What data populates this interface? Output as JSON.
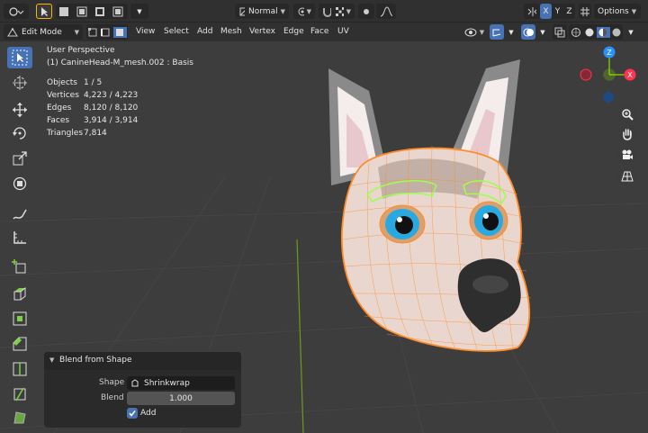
{
  "topbar": {
    "transform_orientation": "Normal",
    "axis_x": "X",
    "axis_y": "Y",
    "axis_z": "Z",
    "options_label": "Options"
  },
  "header": {
    "mode": "Edit Mode",
    "menus": [
      "View",
      "Select",
      "Add",
      "Mesh",
      "Vertex",
      "Edge",
      "Face",
      "UV"
    ]
  },
  "overlay": {
    "view_name": "User Perspective",
    "object_name": "(1) CanineHead-M_mesh.002 : Basis",
    "stats": [
      {
        "label": "Objects",
        "value": "1 / 5"
      },
      {
        "label": "Vertices",
        "value": "4,223 / 4,223"
      },
      {
        "label": "Edges",
        "value": "8,120 / 8,120"
      },
      {
        "label": "Faces",
        "value": "3,914 / 3,914"
      },
      {
        "label": "Triangles",
        "value": "7,814"
      }
    ]
  },
  "gizmo": {
    "z": "Z",
    "y": "Y",
    "x": "X"
  },
  "operator_panel": {
    "title": "Blend from Shape",
    "shape_label": "Shape",
    "shape_value": "Shrinkwrap",
    "blend_label": "Blend",
    "blend_value": "1.000",
    "add_label": "Add",
    "add_checked": true
  },
  "colors": {
    "accent": "#4772b3",
    "axis_x": "#ff3352",
    "axis_y": "#8bdc00",
    "axis_z": "#2890ff",
    "selection": "#ff8c2a"
  }
}
